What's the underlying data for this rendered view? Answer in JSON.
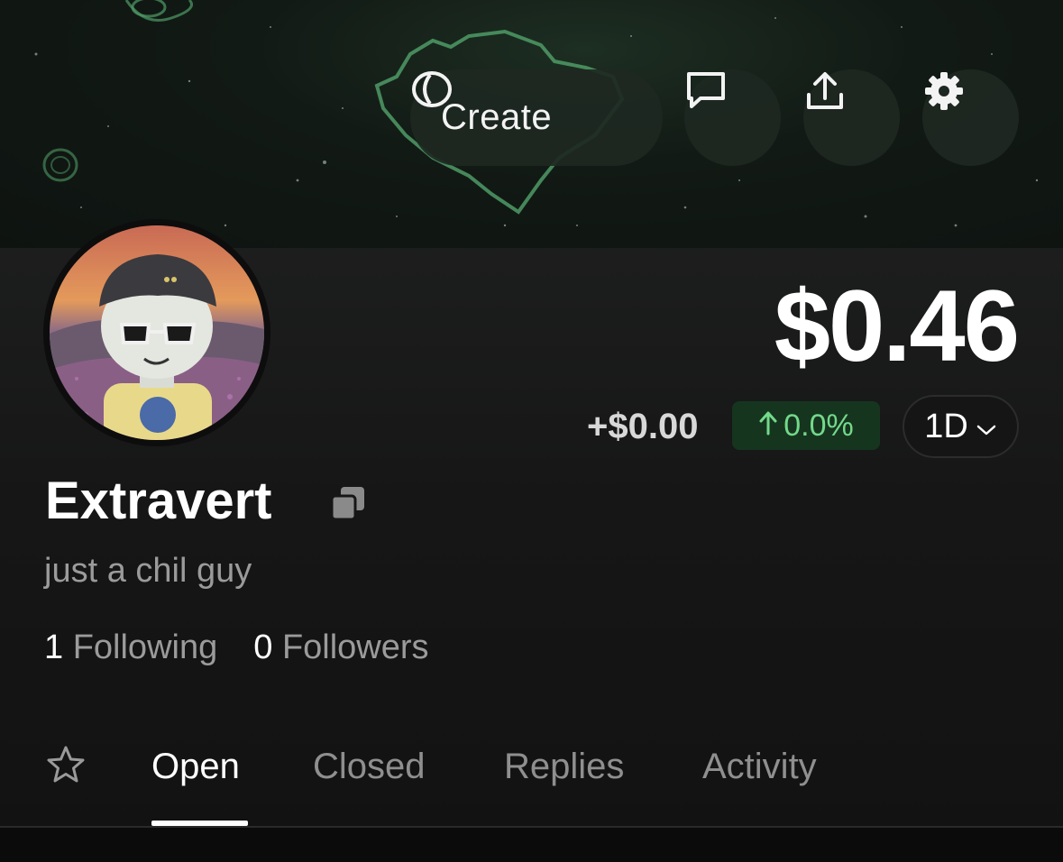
{
  "header": {
    "create_label": "Create",
    "icons": {
      "create": "manifold-icon",
      "messages": "message-square-icon",
      "share": "share-upload-icon",
      "settings": "gear-icon"
    }
  },
  "profile": {
    "name": "Extravert",
    "bio": "just a chil guy",
    "following_count": "1",
    "following_label": "Following",
    "followers_count": "0",
    "followers_label": "Followers"
  },
  "portfolio": {
    "balance": "$0.46",
    "change_amount": "+$0.00",
    "change_percent": "0.0%",
    "range": "1D"
  },
  "tabs": [
    {
      "label": "Open",
      "active": true
    },
    {
      "label": "Closed",
      "active": false
    },
    {
      "label": "Replies",
      "active": false
    },
    {
      "label": "Activity",
      "active": false
    }
  ],
  "colors": {
    "accent_green": "#73d98a",
    "badge_green_bg": "#16351f",
    "banner_green": "#3f8a5a"
  }
}
